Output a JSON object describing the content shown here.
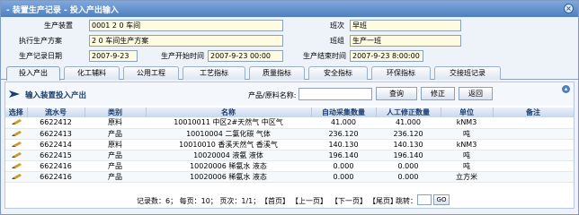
{
  "window": {
    "title": "- 装置生产记录 - 投入产出输入"
  },
  "form": {
    "device_label": "生产装置",
    "device_value": "0001 2 0 车间",
    "team_label": "班次",
    "team_value": "早班",
    "plan_label": "执行生产方案",
    "plan_value": "2 0 车间生产方案",
    "group_label": "班组",
    "group_value": "生产一班",
    "record_date_label": "生产记录日期",
    "record_date_value": "2007-9-23",
    "start_label": "生产开始时间",
    "start_value": "2007-9-23 00:00",
    "end_label": "生产结束时间",
    "end_value": "2007-9-23 8:00:00"
  },
  "tabs": [
    "投入产出",
    "化工辅料",
    "公用工程",
    "工艺指标",
    "质量指标",
    "安全指标",
    "环保指标",
    "交接班记录"
  ],
  "subbar": {
    "title": "输入装置投入产出",
    "search_label": "产品/原料名称:",
    "query": "查询",
    "edit": "修正",
    "back": "返回"
  },
  "columns": [
    "选择",
    "流水号",
    "类别",
    "名称",
    "自动采集数量",
    "人工修正数量",
    "单位",
    "备注"
  ],
  "rows": [
    {
      "id": "6622412",
      "type": "原料",
      "name": "10010011 中区2#天然气 中区气",
      "auto": "41.000",
      "manual": "41.000",
      "unit": "kNM3",
      "note": ""
    },
    {
      "id": "6622413",
      "type": "产品",
      "name": "10010004 二氯化碳 气体",
      "auto": "236.120",
      "manual": "236.120",
      "unit": "吨",
      "note": ""
    },
    {
      "id": "6622414",
      "type": "原料",
      "name": "10010010 香溪天然气 香溪气",
      "auto": "140.130",
      "manual": "140.130",
      "unit": "kNM3",
      "note": ""
    },
    {
      "id": "6622415",
      "type": "产品",
      "name": "10020004 液氨 液体",
      "auto": "196.140",
      "manual": "196.140",
      "unit": "吨",
      "note": ""
    },
    {
      "id": "6622416",
      "type": "产品",
      "name": "10020006 稀氨水 液态",
      "auto": "0.000",
      "manual": "0.000",
      "unit": "吨",
      "note": ""
    },
    {
      "id": "6622416",
      "type": "产品",
      "name": "10020006 稀氨水 液态",
      "auto": "0.000",
      "manual": "0.000",
      "unit": "立方米",
      "note": ""
    }
  ],
  "pager": {
    "info": "记录数：6；  每页：10；  页次：1/1；",
    "first": "【首页】",
    "prev": "【上一页】",
    "next": "【下一页】",
    "last": "【尾页】",
    "jump": "跳转：",
    "go": "GO"
  },
  "colors": {
    "title_bar": "#4f7fc0",
    "accent": "#1b3d6d",
    "required_field": "#fffbe0"
  }
}
